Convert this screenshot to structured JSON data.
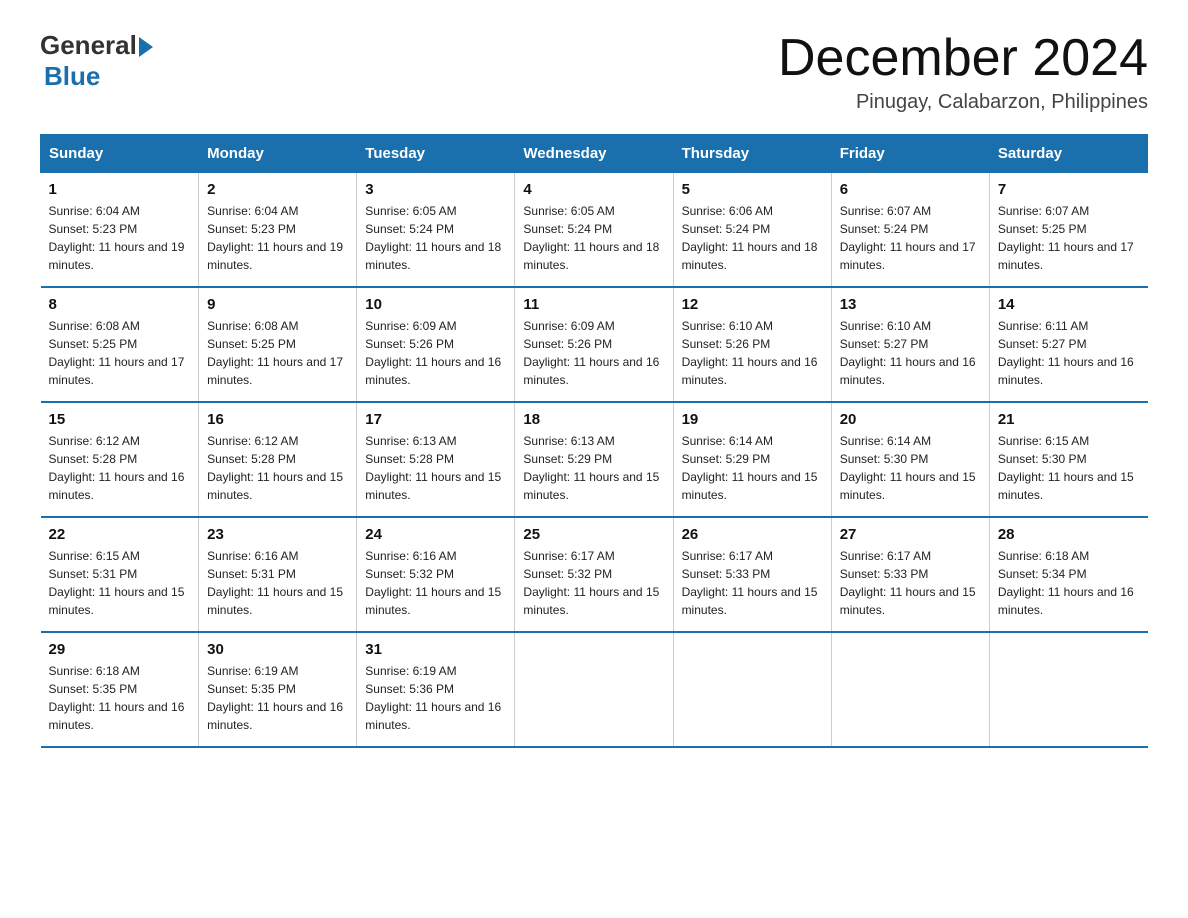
{
  "logo": {
    "general": "General",
    "blue": "Blue"
  },
  "title": "December 2024",
  "subtitle": "Pinugay, Calabarzon, Philippines",
  "headers": [
    "Sunday",
    "Monday",
    "Tuesday",
    "Wednesday",
    "Thursday",
    "Friday",
    "Saturday"
  ],
  "weeks": [
    [
      {
        "day": "1",
        "sunrise": "6:04 AM",
        "sunset": "5:23 PM",
        "daylight": "11 hours and 19 minutes."
      },
      {
        "day": "2",
        "sunrise": "6:04 AM",
        "sunset": "5:23 PM",
        "daylight": "11 hours and 19 minutes."
      },
      {
        "day": "3",
        "sunrise": "6:05 AM",
        "sunset": "5:24 PM",
        "daylight": "11 hours and 18 minutes."
      },
      {
        "day": "4",
        "sunrise": "6:05 AM",
        "sunset": "5:24 PM",
        "daylight": "11 hours and 18 minutes."
      },
      {
        "day": "5",
        "sunrise": "6:06 AM",
        "sunset": "5:24 PM",
        "daylight": "11 hours and 18 minutes."
      },
      {
        "day": "6",
        "sunrise": "6:07 AM",
        "sunset": "5:24 PM",
        "daylight": "11 hours and 17 minutes."
      },
      {
        "day": "7",
        "sunrise": "6:07 AM",
        "sunset": "5:25 PM",
        "daylight": "11 hours and 17 minutes."
      }
    ],
    [
      {
        "day": "8",
        "sunrise": "6:08 AM",
        "sunset": "5:25 PM",
        "daylight": "11 hours and 17 minutes."
      },
      {
        "day": "9",
        "sunrise": "6:08 AM",
        "sunset": "5:25 PM",
        "daylight": "11 hours and 17 minutes."
      },
      {
        "day": "10",
        "sunrise": "6:09 AM",
        "sunset": "5:26 PM",
        "daylight": "11 hours and 16 minutes."
      },
      {
        "day": "11",
        "sunrise": "6:09 AM",
        "sunset": "5:26 PM",
        "daylight": "11 hours and 16 minutes."
      },
      {
        "day": "12",
        "sunrise": "6:10 AM",
        "sunset": "5:26 PM",
        "daylight": "11 hours and 16 minutes."
      },
      {
        "day": "13",
        "sunrise": "6:10 AM",
        "sunset": "5:27 PM",
        "daylight": "11 hours and 16 minutes."
      },
      {
        "day": "14",
        "sunrise": "6:11 AM",
        "sunset": "5:27 PM",
        "daylight": "11 hours and 16 minutes."
      }
    ],
    [
      {
        "day": "15",
        "sunrise": "6:12 AM",
        "sunset": "5:28 PM",
        "daylight": "11 hours and 16 minutes."
      },
      {
        "day": "16",
        "sunrise": "6:12 AM",
        "sunset": "5:28 PM",
        "daylight": "11 hours and 15 minutes."
      },
      {
        "day": "17",
        "sunrise": "6:13 AM",
        "sunset": "5:28 PM",
        "daylight": "11 hours and 15 minutes."
      },
      {
        "day": "18",
        "sunrise": "6:13 AM",
        "sunset": "5:29 PM",
        "daylight": "11 hours and 15 minutes."
      },
      {
        "day": "19",
        "sunrise": "6:14 AM",
        "sunset": "5:29 PM",
        "daylight": "11 hours and 15 minutes."
      },
      {
        "day": "20",
        "sunrise": "6:14 AM",
        "sunset": "5:30 PM",
        "daylight": "11 hours and 15 minutes."
      },
      {
        "day": "21",
        "sunrise": "6:15 AM",
        "sunset": "5:30 PM",
        "daylight": "11 hours and 15 minutes."
      }
    ],
    [
      {
        "day": "22",
        "sunrise": "6:15 AM",
        "sunset": "5:31 PM",
        "daylight": "11 hours and 15 minutes."
      },
      {
        "day": "23",
        "sunrise": "6:16 AM",
        "sunset": "5:31 PM",
        "daylight": "11 hours and 15 minutes."
      },
      {
        "day": "24",
        "sunrise": "6:16 AM",
        "sunset": "5:32 PM",
        "daylight": "11 hours and 15 minutes."
      },
      {
        "day": "25",
        "sunrise": "6:17 AM",
        "sunset": "5:32 PM",
        "daylight": "11 hours and 15 minutes."
      },
      {
        "day": "26",
        "sunrise": "6:17 AM",
        "sunset": "5:33 PM",
        "daylight": "11 hours and 15 minutes."
      },
      {
        "day": "27",
        "sunrise": "6:17 AM",
        "sunset": "5:33 PM",
        "daylight": "11 hours and 15 minutes."
      },
      {
        "day": "28",
        "sunrise": "6:18 AM",
        "sunset": "5:34 PM",
        "daylight": "11 hours and 16 minutes."
      }
    ],
    [
      {
        "day": "29",
        "sunrise": "6:18 AM",
        "sunset": "5:35 PM",
        "daylight": "11 hours and 16 minutes."
      },
      {
        "day": "30",
        "sunrise": "6:19 AM",
        "sunset": "5:35 PM",
        "daylight": "11 hours and 16 minutes."
      },
      {
        "day": "31",
        "sunrise": "6:19 AM",
        "sunset": "5:36 PM",
        "daylight": "11 hours and 16 minutes."
      },
      null,
      null,
      null,
      null
    ]
  ]
}
